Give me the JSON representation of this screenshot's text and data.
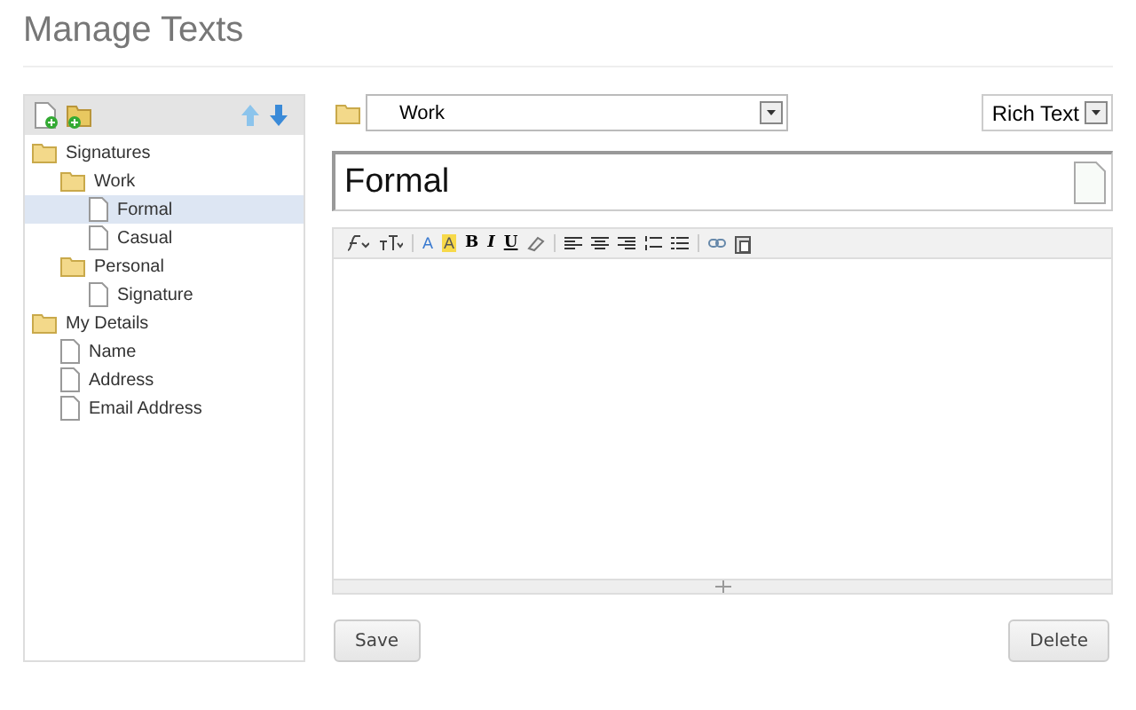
{
  "title": "Manage Texts",
  "tree": [
    {
      "kind": "folder",
      "label": "Signatures",
      "selected": false,
      "children": [
        {
          "kind": "folder",
          "label": "Work",
          "selected": false,
          "children": [
            {
              "kind": "document",
              "label": "Formal",
              "selected": true
            },
            {
              "kind": "document",
              "label": "Casual",
              "selected": false
            }
          ]
        },
        {
          "kind": "folder",
          "label": "Personal",
          "selected": false,
          "children": [
            {
              "kind": "document",
              "label": "Signature",
              "selected": false
            }
          ]
        }
      ]
    },
    {
      "kind": "folder",
      "label": "My Details",
      "selected": false,
      "children": [
        {
          "kind": "document",
          "label": "Name",
          "selected": false
        },
        {
          "kind": "document",
          "label": "Address",
          "selected": false
        },
        {
          "kind": "document",
          "label": "Email Address",
          "selected": false
        }
      ]
    }
  ],
  "folder_select": {
    "value": "Work"
  },
  "format_select": {
    "value": "Rich Text"
  },
  "name_field": {
    "value": "Formal"
  },
  "toolbar": [
    {
      "kind": "font"
    },
    {
      "kind": "size"
    },
    {
      "kind": "sep"
    },
    {
      "kind": "color",
      "label": "A"
    },
    {
      "kind": "highlight",
      "label": "A"
    },
    {
      "kind": "bold",
      "label": "B"
    },
    {
      "kind": "italic",
      "label": "I"
    },
    {
      "kind": "underline",
      "label": "U"
    },
    {
      "kind": "eraser"
    },
    {
      "kind": "sep"
    },
    {
      "kind": "align-left"
    },
    {
      "kind": "align-center"
    },
    {
      "kind": "align-right"
    },
    {
      "kind": "numbered-list"
    },
    {
      "kind": "bullet-list"
    },
    {
      "kind": "sep"
    },
    {
      "kind": "link"
    },
    {
      "kind": "paste"
    }
  ],
  "buttons": {
    "save": "Save",
    "delete": "Delete"
  }
}
